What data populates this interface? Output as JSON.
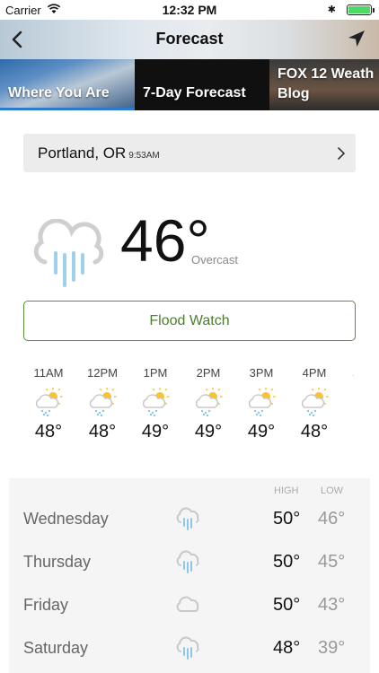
{
  "status": {
    "carrier": "Carrier",
    "time": "12:32 PM",
    "battery_color": "#4cd964"
  },
  "nav": {
    "title": "Forecast",
    "back_icon": "chevron-left-icon",
    "location_icon": "location-arrow-icon"
  },
  "tabs": [
    {
      "label": "Where You Are",
      "active": true
    },
    {
      "label": "7-Day Forecast",
      "active": false
    },
    {
      "label": "FOX 12 Weath",
      "label2": "Blog",
      "active": false
    }
  ],
  "location": {
    "city": "Portland, OR",
    "time": "9:53AM"
  },
  "current": {
    "temp": "46°",
    "condition": "Overcast",
    "icon": "rain-cloud-icon"
  },
  "alert": {
    "label": "Flood Watch",
    "color": "#4a7e2e"
  },
  "hourly": [
    {
      "time": "11AM",
      "temp": "48°",
      "icon": "sun-cloud-rain-icon"
    },
    {
      "time": "12PM",
      "temp": "48°",
      "icon": "sun-cloud-rain-icon"
    },
    {
      "time": "1PM",
      "temp": "49°",
      "icon": "sun-cloud-rain-icon"
    },
    {
      "time": "2PM",
      "temp": "49°",
      "icon": "sun-cloud-rain-icon"
    },
    {
      "time": "3PM",
      "temp": "49°",
      "icon": "sun-cloud-rain-icon"
    },
    {
      "time": "4PM",
      "temp": "48°",
      "icon": "sun-cloud-rain-icon"
    }
  ],
  "daily": {
    "high_header": "HIGH",
    "low_header": "LOW",
    "days": [
      {
        "name": "Wednesday",
        "high": "50°",
        "low": "46°",
        "icon": "rain-cloud-icon"
      },
      {
        "name": "Thursday",
        "high": "50°",
        "low": "45°",
        "icon": "rain-cloud-icon"
      },
      {
        "name": "Friday",
        "high": "50°",
        "low": "43°",
        "icon": "cloud-icon"
      },
      {
        "name": "Saturday",
        "high": "48°",
        "low": "39°",
        "icon": "rain-cloud-icon"
      }
    ]
  }
}
